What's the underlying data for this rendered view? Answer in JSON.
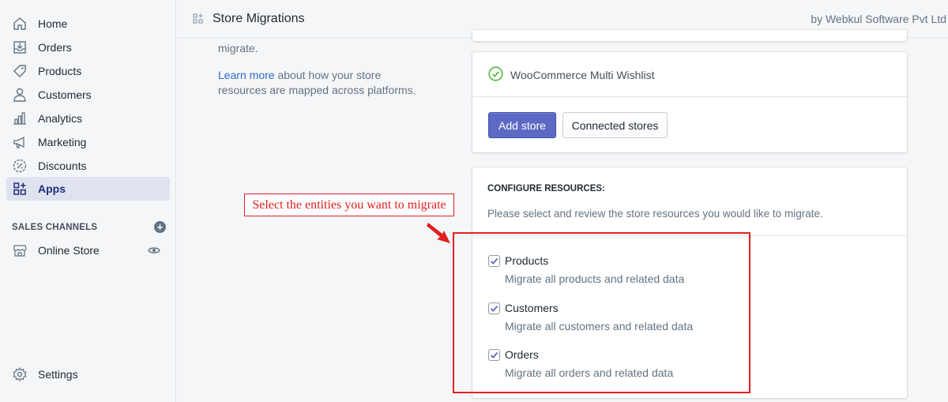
{
  "sidebar": {
    "items": [
      {
        "label": "Home",
        "icon": "home-icon"
      },
      {
        "label": "Orders",
        "icon": "orders-icon"
      },
      {
        "label": "Products",
        "icon": "tag-icon"
      },
      {
        "label": "Customers",
        "icon": "person-icon"
      },
      {
        "label": "Analytics",
        "icon": "bar-chart-icon"
      },
      {
        "label": "Marketing",
        "icon": "megaphone-icon"
      },
      {
        "label": "Discounts",
        "icon": "discount-icon"
      },
      {
        "label": "Apps",
        "icon": "apps-icon",
        "active": true
      }
    ],
    "sales_channels_title": "SALES CHANNELS",
    "online_store_label": "Online Store",
    "settings_label": "Settings"
  },
  "topbar": {
    "title": "Store Migrations",
    "byline": "by Webkul Software Pvt Ltd"
  },
  "left_column": {
    "migrate_text": "migrate.",
    "learn_more_link": "Learn more",
    "learn_more_rest": " about how your store resources are mapped across platforms."
  },
  "store_card": {
    "wishlist_label": "WooCommerce Multi Wishlist",
    "add_store_label": "Add store",
    "connected_stores_label": "Connected stores"
  },
  "configure": {
    "heading": "CONFIGURE RESOURCES:",
    "subtitle": "Please select and review the store resources you would like to migrate.",
    "options": [
      {
        "name": "Products",
        "help": "Migrate all products and related data",
        "checked": true
      },
      {
        "name": "Customers",
        "help": "Migrate all customers and related data",
        "checked": true
      },
      {
        "name": "Orders",
        "help": "Migrate all orders and related data",
        "checked": true
      }
    ]
  },
  "annotation": {
    "text": "Select the entities you want to migrate",
    "color": "#e02020"
  },
  "colors": {
    "primary": "#5c6ac4",
    "success": "#50b83c",
    "link": "#2c6ecb"
  }
}
